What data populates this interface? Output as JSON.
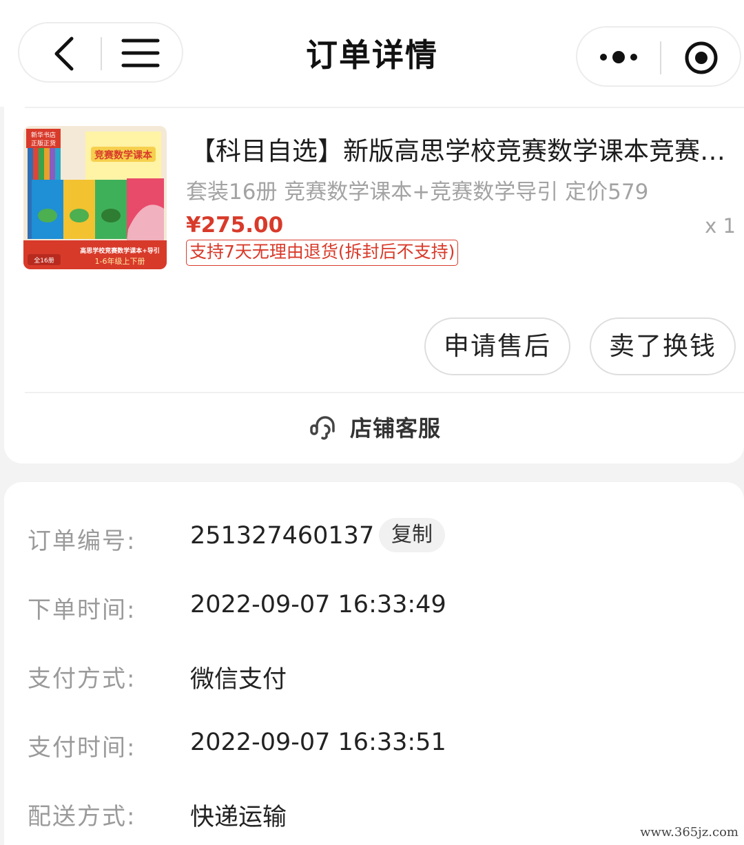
{
  "header": {
    "title": "订单详情"
  },
  "product": {
    "title": "【科目自选】新版高思学校竞赛数学课本竞赛数学导引",
    "spec": "套装16册 竞赛数学课本+竞赛数学导引 定价579",
    "price": "¥275.00",
    "quantity": "x 1",
    "return_policy": "支持7天无理由退货(拆封后不支持)",
    "thumbnail_text": {
      "store_badge_1": "新华书店",
      "store_badge_2": "正版正货",
      "cover_title": "竞赛数学课本",
      "bottom_line_1": "高思学校竞赛数学课本+导引",
      "bottom_line_2": "1-6年级上下册",
      "count_badge": "全16册"
    }
  },
  "actions": {
    "after_sale_label": "申请售后",
    "sell_label": "卖了换钱"
  },
  "service": {
    "label": "店铺客服"
  },
  "order_info": {
    "order_no_label": "订单编号:",
    "order_no_value": "251327460137",
    "copy_label": "复制",
    "order_time_label": "下单时间:",
    "order_time_value": "2022-09-07 16:33:49",
    "pay_method_label": "支付方式:",
    "pay_method_value": "微信支付",
    "pay_time_label": "支付时间:",
    "pay_time_value": "2022-09-07 16:33:51",
    "delivery_label": "配送方式:",
    "delivery_value": "快递运输"
  },
  "watermark": "www.365jz.com",
  "colors": {
    "accent_red": "#d83a2a",
    "muted_text": "#a3a3a3",
    "background": "#f3f3f3"
  }
}
